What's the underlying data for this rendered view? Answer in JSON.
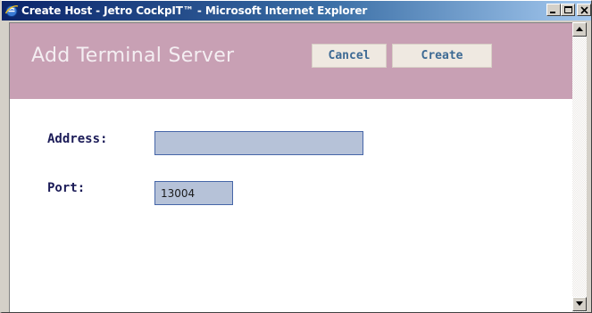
{
  "window": {
    "title": "Create Host - Jetro CockpIT™ - Microsoft Internet Explorer",
    "icon": "ie-icon",
    "controls": [
      "minimize-icon",
      "maximize-icon",
      "close-icon"
    ]
  },
  "header": {
    "title": "Add Terminal Server",
    "cancel_label": "Cancel",
    "create_label": "Create"
  },
  "form": {
    "address_label": "Address:",
    "address_value": "",
    "port_label": "Port:",
    "port_value": "13004"
  },
  "colors": {
    "header_band": "#c8a0b4",
    "label_text": "#1c1c58",
    "button_text": "#3d6a94",
    "input_bg": "#b6c2d8",
    "input_border": "#4666a8"
  }
}
